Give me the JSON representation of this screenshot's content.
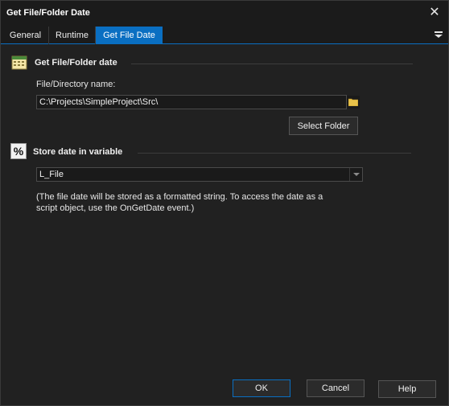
{
  "window": {
    "title": "Get File/Folder Date",
    "close_glyph": "✕"
  },
  "tabs": [
    {
      "label": "General",
      "active": false
    },
    {
      "label": "Runtime",
      "active": false
    },
    {
      "label": "Get File Date",
      "active": true
    }
  ],
  "tab_menu_icon": "hamburger-icon",
  "section_file": {
    "icon": "calendar-icon",
    "title": "Get File/Folder date",
    "field_label": "File/Directory name:",
    "field_value": "C:\\Projects\\SimpleProject\\Src\\",
    "browse_icon": "folder-icon",
    "select_folder_label": "Select Folder"
  },
  "section_store": {
    "icon": "percent-icon",
    "icon_glyph": "%",
    "title": "Store date in variable",
    "variable_value": "L_File",
    "note_line1": "(The file date will be stored as a formatted string. To access the date as a",
    "note_line2": "script object, use the OnGetDate event.)"
  },
  "buttons": {
    "ok": "OK",
    "cancel": "Cancel",
    "help": "Help"
  },
  "colors": {
    "accent": "#0a6fc2",
    "background": "#212121",
    "titlebar": "#1b1b1b"
  }
}
